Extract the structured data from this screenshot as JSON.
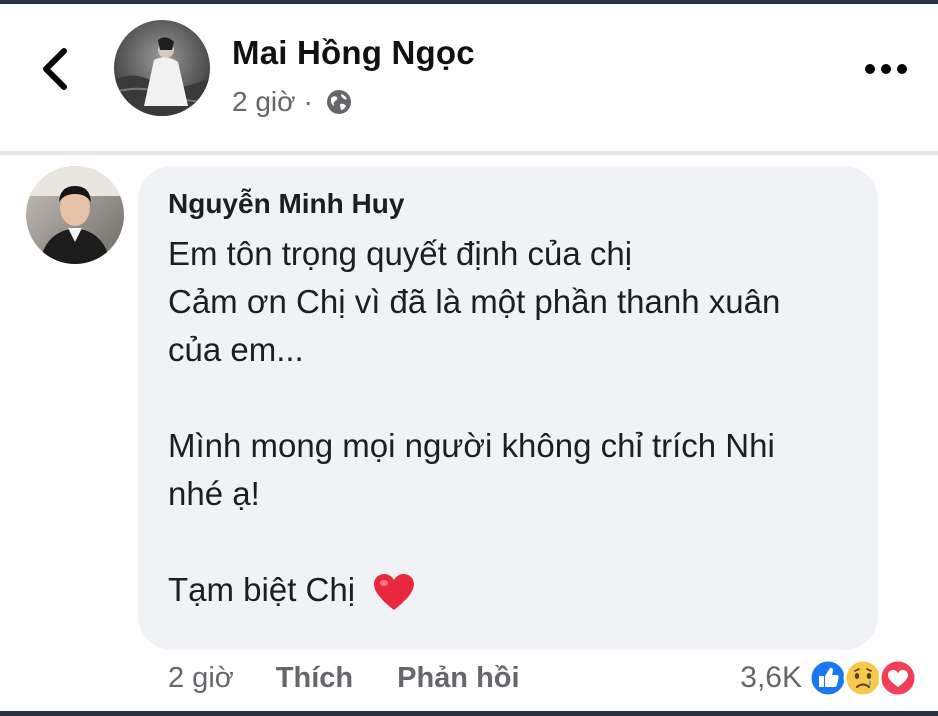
{
  "post": {
    "author": "Mai Hồng Ngọc",
    "time": "2 giờ",
    "separator": "·",
    "privacy_icon": "globe-icon"
  },
  "header": {
    "back_icon": "chevron-left-icon",
    "more_icon": "more-horizontal-icon"
  },
  "comment": {
    "author": "Nguyễn Minh Huy",
    "lines": [
      "Em tôn trọng quyết định của chị",
      "Cảm ơn Chị vì đã là một phần thanh xuân",
      "của em...",
      "",
      "Mình mong mọi người không chỉ trích Nhi",
      "nhé ạ!",
      "",
      "Tạm biệt Chị"
    ],
    "emoji": "red-heart-icon",
    "time": "2 giờ",
    "like_label": "Thích",
    "reply_label": "Phản hồi",
    "reaction_count": "3,6K",
    "reaction_icons": [
      "like-icon",
      "sad-icon",
      "love-icon"
    ]
  },
  "colors": {
    "bubble": "#f0f2f5",
    "secondary_text": "#65676b",
    "like_blue": "#1877f2",
    "love_red": "#f33e58",
    "sad_yellow": "#f7c94b"
  }
}
